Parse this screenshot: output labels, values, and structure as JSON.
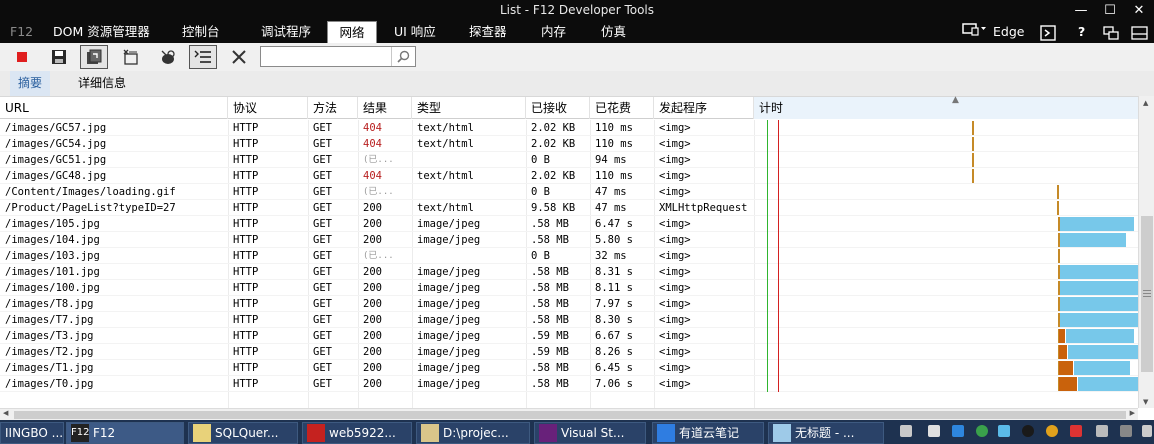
{
  "window": {
    "title": "List - F12 Developer Tools",
    "minimize_glyph": "—",
    "maximize_glyph": "☐",
    "close_glyph": "✕"
  },
  "menu": {
    "items": [
      "F12",
      "DOM 资源管理器",
      "控制台",
      "调试程序",
      "网络",
      "UI 响应",
      "探查器",
      "内存",
      "仿真"
    ],
    "right": {
      "browser": "Edge"
    }
  },
  "search": {
    "value": "",
    "placeholder": ""
  },
  "subtabs": [
    "摘要",
    "详细信息"
  ],
  "columns": [
    "URL",
    "协议",
    "方法",
    "结果",
    "类型",
    "已接收",
    "已花费",
    "发起程序",
    "计时"
  ],
  "rows": [
    {
      "url": "/images/GC57.jpg",
      "protocol": "HTTP",
      "method": "GET",
      "result": "404",
      "type": "text/html",
      "received": "2.02 KB",
      "taken": "110 ms",
      "initiator": "<img>"
    },
    {
      "url": "/images/GC54.jpg",
      "protocol": "HTTP",
      "method": "GET",
      "result": "404",
      "type": "text/html",
      "received": "2.02 KB",
      "taken": "110 ms",
      "initiator": "<img>"
    },
    {
      "url": "/images/GC51.jpg",
      "protocol": "HTTP",
      "method": "GET",
      "result": "(已...",
      "type": "",
      "received": "0 B",
      "taken": "94 ms",
      "initiator": "<img>"
    },
    {
      "url": "/images/GC48.jpg",
      "protocol": "HTTP",
      "method": "GET",
      "result": "404",
      "type": "text/html",
      "received": "2.02 KB",
      "taken": "110 ms",
      "initiator": "<img>"
    },
    {
      "url": "/Content/Images/loading.gif",
      "protocol": "HTTP",
      "method": "GET",
      "result": "(已...",
      "type": "",
      "received": "0 B",
      "taken": "47 ms",
      "initiator": "<img>"
    },
    {
      "url": "/Product/PageList?typeID=27",
      "protocol": "HTTP",
      "method": "GET",
      "result": "200",
      "type": "text/html",
      "received": "9.58 KB",
      "taken": "47 ms",
      "initiator": "XMLHttpRequest"
    },
    {
      "url": "/images/105.jpg",
      "protocol": "HTTP",
      "method": "GET",
      "result": "200",
      "type": "image/jpeg",
      "received": ".58 MB",
      "taken": "6.47 s",
      "initiator": "<img>"
    },
    {
      "url": "/images/104.jpg",
      "protocol": "HTTP",
      "method": "GET",
      "result": "200",
      "type": "image/jpeg",
      "received": ".58 MB",
      "taken": "5.80 s",
      "initiator": "<img>"
    },
    {
      "url": "/images/103.jpg",
      "protocol": "HTTP",
      "method": "GET",
      "result": "(已...",
      "type": "",
      "received": "0 B",
      "taken": "32 ms",
      "initiator": "<img>"
    },
    {
      "url": "/images/101.jpg",
      "protocol": "HTTP",
      "method": "GET",
      "result": "200",
      "type": "image/jpeg",
      "received": ".58 MB",
      "taken": "8.31 s",
      "initiator": "<img>"
    },
    {
      "url": "/images/100.jpg",
      "protocol": "HTTP",
      "method": "GET",
      "result": "200",
      "type": "image/jpeg",
      "received": ".58 MB",
      "taken": "8.11 s",
      "initiator": "<img>"
    },
    {
      "url": "/images/T8.jpg",
      "protocol": "HTTP",
      "method": "GET",
      "result": "200",
      "type": "image/jpeg",
      "received": ".58 MB",
      "taken": "7.97 s",
      "initiator": "<img>"
    },
    {
      "url": "/images/T7.jpg",
      "protocol": "HTTP",
      "method": "GET",
      "result": "200",
      "type": "image/jpeg",
      "received": ".58 MB",
      "taken": "8.30 s",
      "initiator": "<img>"
    },
    {
      "url": "/images/T3.jpg",
      "protocol": "HTTP",
      "method": "GET",
      "result": "200",
      "type": "image/jpeg",
      "received": ".59 MB",
      "taken": "6.67 s",
      "initiator": "<img>"
    },
    {
      "url": "/images/T2.jpg",
      "protocol": "HTTP",
      "method": "GET",
      "result": "200",
      "type": "image/jpeg",
      "received": ".59 MB",
      "taken": "8.26 s",
      "initiator": "<img>"
    },
    {
      "url": "/images/T1.jpg",
      "protocol": "HTTP",
      "method": "GET",
      "result": "200",
      "type": "image/jpeg",
      "received": ".58 MB",
      "taken": "6.45 s",
      "initiator": "<img>"
    },
    {
      "url": "/images/T0.jpg",
      "protocol": "HTTP",
      "method": "GET",
      "result": "200",
      "type": "image/jpeg",
      "received": ".58 MB",
      "taken": "7.06 s",
      "initiator": "<img>"
    }
  ],
  "taskbar": {
    "items": [
      "IINGBO ...",
      "F12",
      "SQLQuer...",
      "web5922...",
      "D:\\projec...",
      "Visual St...",
      "有道云笔记",
      "无标题 - ..."
    ]
  },
  "colors": {
    "status_404": "#b81f1f",
    "waiting_bar": "#c9620c",
    "receiving_bar": "#77c8ea",
    "dom_content_line": "#2fb52f",
    "load_line": "#d42020",
    "active_subtab": "#2a5f9e"
  },
  "icons": {
    "toolbar": [
      "stop-recording-icon",
      "save-icon",
      "always-refresh-icon",
      "clear-entries-icon",
      "clear-cache-icon",
      "filter-icon",
      "clear-icon",
      "search-icon"
    ],
    "menu_right": [
      "emulation-device-icon",
      "console-icon",
      "help-icon",
      "undock-icon",
      "dock-icon"
    ]
  }
}
